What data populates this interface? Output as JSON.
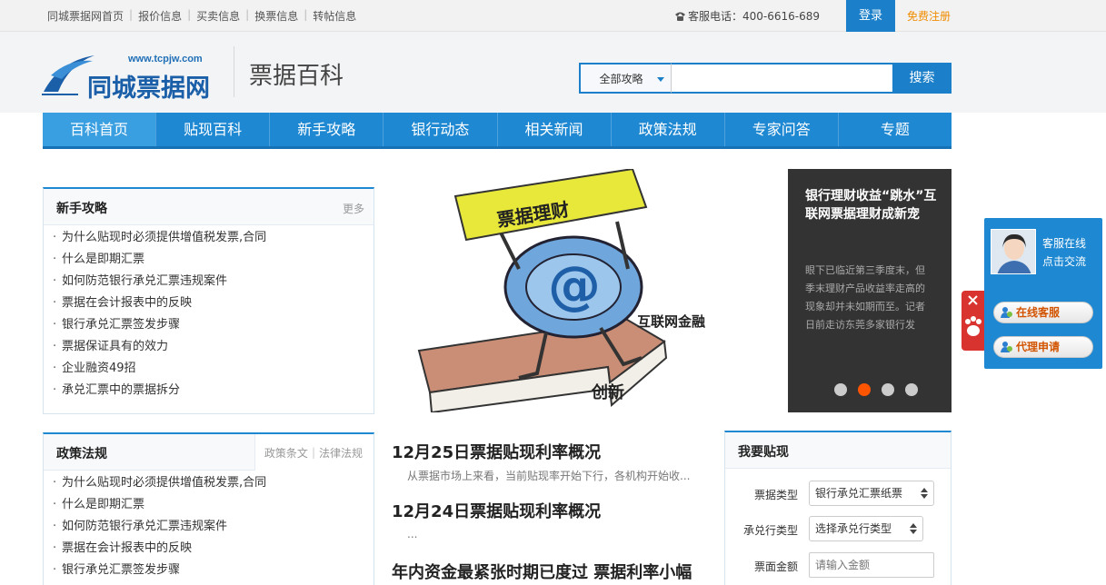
{
  "topbar": {
    "links": [
      "同城票据网首页",
      "报价信息",
      "买卖信息",
      "换票信息",
      "转帖信息"
    ],
    "hotline": "客服电话：400-6616-689",
    "login": "登录",
    "register": "免费注册"
  },
  "header": {
    "logo_url": "www.tcpjw.com",
    "logo_name": "同城票据网",
    "section_title": "票据百科",
    "search": {
      "category": "全部攻略",
      "placeholder": "",
      "button": "搜索"
    }
  },
  "nav": [
    "百科首页",
    "贴现百科",
    "新手攻略",
    "银行动态",
    "相关新闻",
    "政策法规",
    "专家问答",
    "专题"
  ],
  "newbie": {
    "title": "新手攻略",
    "more": "更多",
    "items": [
      "为什么贴现时必须提供增值税发票,合同",
      "什么是即期汇票",
      "如何防范银行承兑汇票违规案件",
      "票据在会计报表中的反映",
      "银行承兑汇票签发步骤",
      "票据保证具有的效力",
      "企业融资49招",
      "承兑汇票中的票据拆分"
    ]
  },
  "policy": {
    "title": "政策法规",
    "tabs": [
      "政策条文",
      "法律法规"
    ],
    "items": [
      "为什么贴现时必须提供增值税发票,合同",
      "什么是即期汇票",
      "如何防范银行承兑汇票违规案件",
      "票据在会计报表中的反映",
      "银行承兑汇票签发步骤"
    ]
  },
  "banner": {
    "image_sign": "票据理财",
    "image_caption": "互联网金融",
    "image_arrow": "创新",
    "title": "银行理财收益“跳水”互联网票据理财成新宠",
    "desc": "眼下已临近第三季度末，但季末理财产品收益率走高的现象却并未如期而至。记者日前走访东莞多家银行发",
    "dots": 4,
    "active_dot": 1
  },
  "news": [
    {
      "title": "12月25日票据贴现利率概况",
      "summary": "从票据市场上来看，当前贴现率开始下行，各机构开始收..."
    },
    {
      "title": "12月24日票据贴现利率概况",
      "summary": "..."
    },
    {
      "title": "年内资金最紧张时期已度过 票据利率小幅",
      "summary": ""
    }
  ],
  "discount_form": {
    "title": "我要贴现",
    "fields": [
      {
        "label": "票据类型",
        "value": "银行承兑汇票纸票"
      },
      {
        "label": "承兑行类型",
        "value": "选择承兑行类型"
      },
      {
        "label": "票面金额",
        "placeholder": "请输入金额"
      }
    ]
  },
  "service": {
    "line1": "客服在线",
    "line2": "点击交流",
    "online_btn": "在线客服",
    "agent_btn": "代理申请"
  },
  "colors": {
    "primary": "#1e88d2",
    "accent": "#ff5500",
    "register": "#f08c00"
  }
}
